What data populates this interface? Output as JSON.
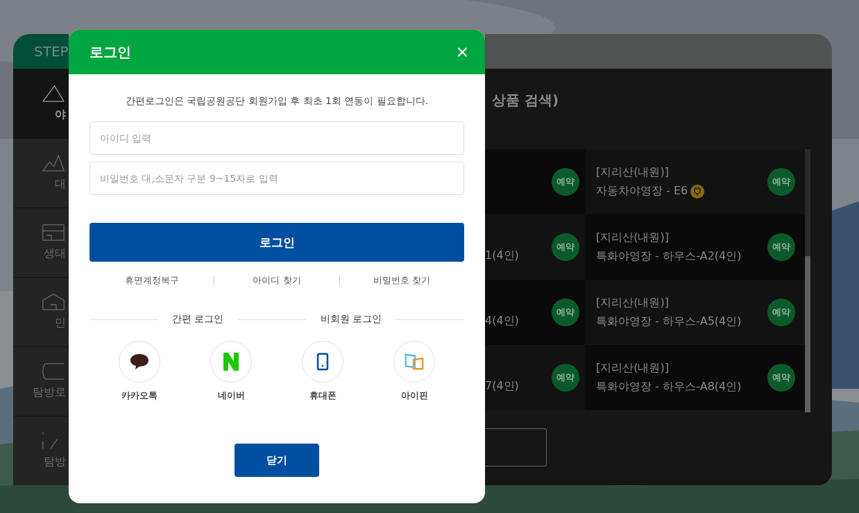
{
  "sidebar": {
    "header": "STEP",
    "items": [
      {
        "label": "야",
        "selected": true
      },
      {
        "label": "대",
        "selected": false
      },
      {
        "label": "생태",
        "selected": false
      },
      {
        "label": "민",
        "selected": false
      },
      {
        "label": "탐방로",
        "selected": false
      },
      {
        "label": "탐방",
        "selected": false
      }
    ]
  },
  "login_dialog": {
    "title": "로그인",
    "close": "×",
    "notice": "간편로그인은 국립공원공단 회원가입 후 최초 1회 연동이 필요합니다.",
    "fields": [
      {
        "placeholder": "아이디 입력"
      },
      {
        "placeholder": "비밀번호 대,소문자 구분 9~15자로 입력"
      }
    ],
    "login_button": "로그인",
    "links": [
      "휴면계정복구",
      "아이디 찾기",
      "비밀번호 찾기"
    ],
    "sections": [
      "간편 로그인",
      "비회원 로그인"
    ],
    "providers": [
      {
        "label": "카카오톡",
        "kind": "kakao"
      },
      {
        "label": "네이버",
        "kind": "naver"
      },
      {
        "label": "휴대폰",
        "kind": "phone"
      },
      {
        "label": "아이핀",
        "kind": "ipin"
      }
    ],
    "close_button": "닫기"
  },
  "main": {
    "title": "상품 검색)",
    "rows": [
      {
        "cells": [
          {
            "button": "예약"
          },
          {
            "place": "[지리산(내원)]",
            "detail": "자동차야영장 - E6",
            "electric": true,
            "button": "예약"
          }
        ]
      },
      {
        "cells": [
          {
            "detail": "1(4인)",
            "button": "예약"
          },
          {
            "place": "[지리산(내원)]",
            "detail": "특화야영장 - 하우스-A2(4인)",
            "button": "예약"
          }
        ]
      },
      {
        "cells": [
          {
            "detail": "4(4인)",
            "button": "예약"
          },
          {
            "place": "[지리산(내원)]",
            "detail": "특화야영장 - 하우스-A5(4인)",
            "button": "예약"
          }
        ]
      },
      {
        "cells": [
          {
            "detail": "7(4인)",
            "button": "예약"
          },
          {
            "place": "[지리산(내원)]",
            "detail": "특화야영장 - 하우스-A8(4인)",
            "button": "예약"
          }
        ]
      }
    ]
  }
}
